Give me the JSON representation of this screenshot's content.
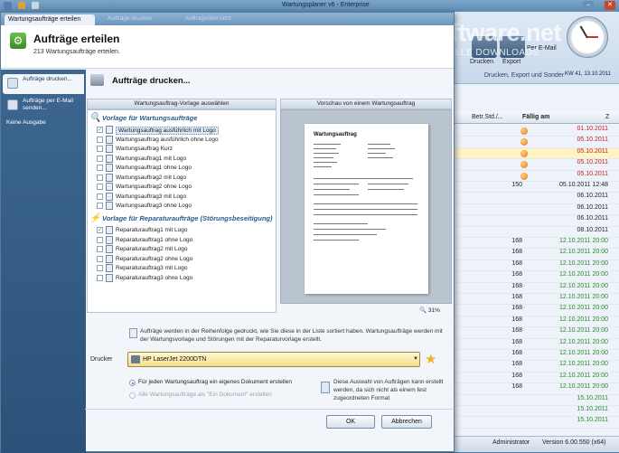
{
  "background_app": {
    "title": "Wartungsplaner v6 - Enterprise",
    "watermark": "software.net",
    "watermark_sub": "AKTUELLE DOWNLOADS",
    "ribbon": {
      "button1": "Drucken",
      "button2": "Export",
      "button3": "Per E-Mail",
      "group_label": "Drucken, Export und Sonder",
      "calendar_week": "KW 41, 13.10.2011"
    },
    "grid": {
      "col_betr_std": "Betr.Std./...",
      "col_faellig": "Fällig am",
      "col_z": "Z",
      "rows": [
        {
          "betr": "",
          "date": "01.10.2011",
          "color": "#c42020",
          "dot": true,
          "selected": false
        },
        {
          "betr": "",
          "date": "05.10.2011",
          "color": "#c42020",
          "dot": true,
          "selected": false
        },
        {
          "betr": "",
          "date": "05.10.2011",
          "color": "#c42020",
          "dot": true,
          "selected": true
        },
        {
          "betr": "",
          "date": "05.10.2011",
          "color": "#c42020",
          "dot": true,
          "selected": false
        },
        {
          "betr": "",
          "date": "05.10.2011",
          "color": "#c42020",
          "dot": true,
          "selected": false
        },
        {
          "betr": "150",
          "date": "05.10.2011 12:48",
          "color": "#222222",
          "dot": false,
          "selected": false
        },
        {
          "betr": "",
          "date": "06.10.2011",
          "color": "#222222",
          "dot": false,
          "selected": false
        },
        {
          "betr": "",
          "date": "06.10.2011",
          "color": "#222222",
          "dot": false,
          "selected": false
        },
        {
          "betr": "",
          "date": "06.10.2011",
          "color": "#222222",
          "dot": false,
          "selected": false
        },
        {
          "betr": "",
          "date": "08.10.2011",
          "color": "#222222",
          "dot": false,
          "selected": false
        },
        {
          "betr": "168",
          "date": "12.10.2011 20:00",
          "color": "#2a8a2a",
          "dot": false,
          "selected": false
        },
        {
          "betr": "168",
          "date": "12.10.2011 20:00",
          "color": "#2a8a2a",
          "dot": false,
          "selected": false
        },
        {
          "betr": "168",
          "date": "12.10.2011 20:00",
          "color": "#2a8a2a",
          "dot": false,
          "selected": false
        },
        {
          "betr": "168",
          "date": "12.10.2011 20:00",
          "color": "#2a8a2a",
          "dot": false,
          "selected": false
        },
        {
          "betr": "168",
          "date": "12.10.2011 20:00",
          "color": "#2a8a2a",
          "dot": false,
          "selected": false
        },
        {
          "betr": "168",
          "date": "12.10.2011 20:00",
          "color": "#2a8a2a",
          "dot": false,
          "selected": false
        },
        {
          "betr": "168",
          "date": "12.10.2011 20:00",
          "color": "#2a8a2a",
          "dot": false,
          "selected": false
        },
        {
          "betr": "168",
          "date": "12.10.2011 20:00",
          "color": "#2a8a2a",
          "dot": false,
          "selected": false
        },
        {
          "betr": "168",
          "date": "12.10.2011 20:00",
          "color": "#2a8a2a",
          "dot": false,
          "selected": false
        },
        {
          "betr": "168",
          "date": "12.10.2011 20:00",
          "color": "#2a8a2a",
          "dot": false,
          "selected": false
        },
        {
          "betr": "168",
          "date": "12.10.2011 20:00",
          "color": "#2a8a2a",
          "dot": false,
          "selected": false
        },
        {
          "betr": "168",
          "date": "12.10.2011 20:00",
          "color": "#2a8a2a",
          "dot": false,
          "selected": false
        },
        {
          "betr": "168",
          "date": "12.10.2011 20:00",
          "color": "#2a8a2a",
          "dot": false,
          "selected": false
        },
        {
          "betr": "168",
          "date": "12.10.2011 20:00",
          "color": "#2a8a2a",
          "dot": false,
          "selected": false
        },
        {
          "betr": "",
          "date": "15.10.2011",
          "color": "#2a8a2a",
          "dot": false,
          "selected": false
        },
        {
          "betr": "",
          "date": "15.10.2011",
          "color": "#2a8a2a",
          "dot": false,
          "selected": false
        },
        {
          "betr": "",
          "date": "15.10.2011",
          "color": "#2a8a2a",
          "dot": false,
          "selected": false
        }
      ]
    },
    "status": {
      "user": "Administrator",
      "version": "Version 6.00.550 (x64)"
    }
  },
  "dialog": {
    "tabs": [
      "Wartungsaufträge erteilen",
      "Aufträge drucken",
      "Auftragsübersicht"
    ],
    "header_title": "Aufträge erteilen",
    "header_sub": "213 Wartungsaufträge erteilen.",
    "sidebar": [
      {
        "label": "Aufträge drucken...",
        "active": true
      },
      {
        "label": "Aufträge per E-Mail senden...",
        "active": false
      },
      {
        "label": "Keine Ausgabe",
        "active": false
      }
    ],
    "main_title": "Aufträge drucken...",
    "col_left": "Wartungsauftrag-Vorlage auswählen",
    "col_right": "Vorschau von einem Wartungsauftrag",
    "group1": "Vorlage für Wartungsaufträge",
    "group1_items": [
      {
        "label": "Wartungsauftrag ausführlich mit Logo",
        "checked": true,
        "selected": true
      },
      {
        "label": "Wartungsauftrag ausführlich ohne Logo",
        "checked": false,
        "selected": false
      },
      {
        "label": "Wartungsauftrag Kurz",
        "checked": false,
        "selected": false
      },
      {
        "label": "Wartungsauftrag1 mit Logo",
        "checked": false,
        "selected": false
      },
      {
        "label": "Wartungsauftrag1 ohne Logo",
        "checked": false,
        "selected": false
      },
      {
        "label": "Wartungsauftrag2 mit Logo",
        "checked": false,
        "selected": false
      },
      {
        "label": "Wartungsauftrag2 ohne Logo",
        "checked": false,
        "selected": false
      },
      {
        "label": "Wartungsauftrag3 mit Logo",
        "checked": false,
        "selected": false
      },
      {
        "label": "Wartungsauftrag3 ohne Logo",
        "checked": false,
        "selected": false
      }
    ],
    "group2": "Vorlage für Reparaturaufträge (Störungsbeseitigung)",
    "group2_items": [
      {
        "label": "Reparaturauftrag1 mit Logo",
        "checked": true,
        "selected": false
      },
      {
        "label": "Reparaturauftrag1 ohne Logo",
        "checked": false,
        "selected": false
      },
      {
        "label": "Reparaturauftrag2 mit Logo",
        "checked": false,
        "selected": false
      },
      {
        "label": "Reparaturauftrag2 ohne Logo",
        "checked": false,
        "selected": false
      },
      {
        "label": "Reparaturauftrag3 mit Logo",
        "checked": false,
        "selected": false
      },
      {
        "label": "Reparaturauftrag3 ohne Logo",
        "checked": false,
        "selected": false
      }
    ],
    "preview_zoom": "31%",
    "preview_doc_title": "Wartungsauftrag",
    "info_text": "Aufträge werden in der Reihenfolge gedruckt, wie Sie diese in der Liste sortiert haben. Wartungsaufträge werden mit der Wartungsvorlage und Störungen mit der Reparaturvorlage erstellt.",
    "printer_label": "Drucker",
    "printer_value": "HP LaserJet 2200DTN",
    "option1": "Für jeden Wartungsauftrag ein eigenes Dokument erstellen",
    "option2": "Alle Wartungsaufträge als \"Ein Dokument\" erstellen",
    "option_info": "Diese Auswahl von Aufträgen kann erstellt werden, da sich nicht als einem fest zugeordneten Format",
    "ok": "OK",
    "cancel": "Abbrechen"
  }
}
